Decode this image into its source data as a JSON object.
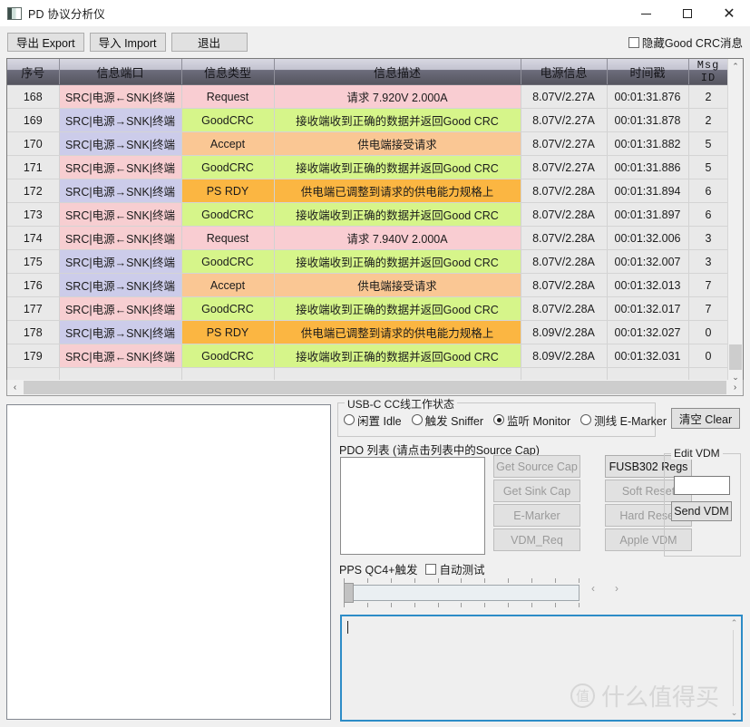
{
  "window": {
    "title": "PD 协议分析仪",
    "icon": "app-icon",
    "minimize": "—",
    "maximize": "□",
    "close": "✕"
  },
  "toolbar": {
    "export_label": "导出 Export",
    "import_label": "导入 Import",
    "exit_label": "退出",
    "hide_goodcrc_label": "隐藏Good CRC消息",
    "hide_goodcrc_checked": false
  },
  "table": {
    "columns": [
      "序号",
      "信息端口",
      "信息类型",
      "信息描述",
      "电源信息",
      "时间戳",
      "Msg ID"
    ],
    "rows": [
      {
        "seq": "168",
        "port": "SRC|电源←SNK|终端",
        "port_dir": "sink",
        "type": "Request",
        "type_kind": "req",
        "desc": "请求 7.920V 2.000A",
        "power": "8.07V/2.27A",
        "time": "00:01:31.876",
        "msgid": "2"
      },
      {
        "seq": "169",
        "port": "SRC|电源→SNK|终端",
        "port_dir": "src",
        "type": "GoodCRC",
        "type_kind": "crc",
        "desc": "接收端收到正确的数据并返回Good CRC",
        "power": "8.07V/2.27A",
        "time": "00:01:31.878",
        "msgid": "2"
      },
      {
        "seq": "170",
        "port": "SRC|电源→SNK|终端",
        "port_dir": "src",
        "type": "Accept",
        "type_kind": "accept",
        "desc": "供电端接受请求",
        "power": "8.07V/2.27A",
        "time": "00:01:31.882",
        "msgid": "5"
      },
      {
        "seq": "171",
        "port": "SRC|电源←SNK|终端",
        "port_dir": "sink",
        "type": "GoodCRC",
        "type_kind": "crc",
        "desc": "接收端收到正确的数据并返回Good CRC",
        "power": "8.07V/2.27A",
        "time": "00:01:31.886",
        "msgid": "5"
      },
      {
        "seq": "172",
        "port": "SRC|电源→SNK|终端",
        "port_dir": "src",
        "type": "PS RDY",
        "type_kind": "psrdy",
        "desc": "供电端已调整到请求的供电能力规格上",
        "power": "8.07V/2.28A",
        "time": "00:01:31.894",
        "msgid": "6"
      },
      {
        "seq": "173",
        "port": "SRC|电源←SNK|终端",
        "port_dir": "sink",
        "type": "GoodCRC",
        "type_kind": "crc",
        "desc": "接收端收到正确的数据并返回Good CRC",
        "power": "8.07V/2.28A",
        "time": "00:01:31.897",
        "msgid": "6"
      },
      {
        "seq": "174",
        "port": "SRC|电源←SNK|终端",
        "port_dir": "sink",
        "type": "Request",
        "type_kind": "req",
        "desc": "请求 7.940V 2.000A",
        "power": "8.07V/2.28A",
        "time": "00:01:32.006",
        "msgid": "3"
      },
      {
        "seq": "175",
        "port": "SRC|电源→SNK|终端",
        "port_dir": "src",
        "type": "GoodCRC",
        "type_kind": "crc",
        "desc": "接收端收到正确的数据并返回Good CRC",
        "power": "8.07V/2.28A",
        "time": "00:01:32.007",
        "msgid": "3"
      },
      {
        "seq": "176",
        "port": "SRC|电源→SNK|终端",
        "port_dir": "src",
        "type": "Accept",
        "type_kind": "accept",
        "desc": "供电端接受请求",
        "power": "8.07V/2.28A",
        "time": "00:01:32.013",
        "msgid": "7"
      },
      {
        "seq": "177",
        "port": "SRC|电源←SNK|终端",
        "port_dir": "sink",
        "type": "GoodCRC",
        "type_kind": "crc",
        "desc": "接收端收到正确的数据并返回Good CRC",
        "power": "8.07V/2.28A",
        "time": "00:01:32.017",
        "msgid": "7"
      },
      {
        "seq": "178",
        "port": "SRC|电源→SNK|终端",
        "port_dir": "src",
        "type": "PS RDY",
        "type_kind": "psrdy",
        "desc": "供电端已调整到请求的供电能力规格上",
        "power": "8.09V/2.28A",
        "time": "00:01:32.027",
        "msgid": "0"
      },
      {
        "seq": "179",
        "port": "SRC|电源←SNK|终端",
        "port_dir": "sink",
        "type": "GoodCRC",
        "type_kind": "crc",
        "desc": "接收端收到正确的数据并返回Good CRC",
        "power": "8.09V/2.28A",
        "time": "00:01:32.031",
        "msgid": "0"
      }
    ]
  },
  "cc_status": {
    "legend": "USB-C CC线工作状态",
    "options": [
      {
        "label": "闲置 Idle",
        "selected": false
      },
      {
        "label": "触发 Sniffer",
        "selected": false
      },
      {
        "label": "监听 Monitor",
        "selected": true
      },
      {
        "label": "测线 E-Marker",
        "selected": false
      }
    ]
  },
  "clear_button": "清空 Clear",
  "pdo": {
    "label": "PDO 列表 (请点击列表中的Source Cap)",
    "items": []
  },
  "action_buttons": {
    "col_a": [
      {
        "label": "Get Source Cap",
        "enabled": false
      },
      {
        "label": "Get Sink Cap",
        "enabled": false
      },
      {
        "label": "E-Marker",
        "enabled": false
      },
      {
        "label": "VDM_Req",
        "enabled": false
      }
    ],
    "col_b": [
      {
        "label": "FUSB302 Regs",
        "enabled": true
      },
      {
        "label": "Soft Reset",
        "enabled": false
      },
      {
        "label": "Hard Reset",
        "enabled": false
      },
      {
        "label": "Apple VDM",
        "enabled": false
      }
    ]
  },
  "edit_vdm": {
    "legend": "Edit VDM",
    "input_value": "",
    "send_label": "Send VDM"
  },
  "pps": {
    "label": "PPS QC4+触发",
    "auto_test_label": "自动测试",
    "auto_test_checked": false,
    "slider_value": 0,
    "tick_count": 11,
    "prev_glyph": "‹",
    "next_glyph": "›"
  },
  "log": {
    "value": "",
    "up_glyph": "⌃",
    "down_glyph": "⌄"
  },
  "watermark": {
    "badge": "值",
    "text": "什么值得买"
  },
  "colors": {
    "request": "#f9cdd2",
    "goodcrc": "#d6f58a",
    "accept": "#fac794",
    "psrdy": "#fbb642",
    "port_sink": "#f0cfd1",
    "port_src": "#ccccea",
    "focus_border": "#2d8cc7"
  }
}
